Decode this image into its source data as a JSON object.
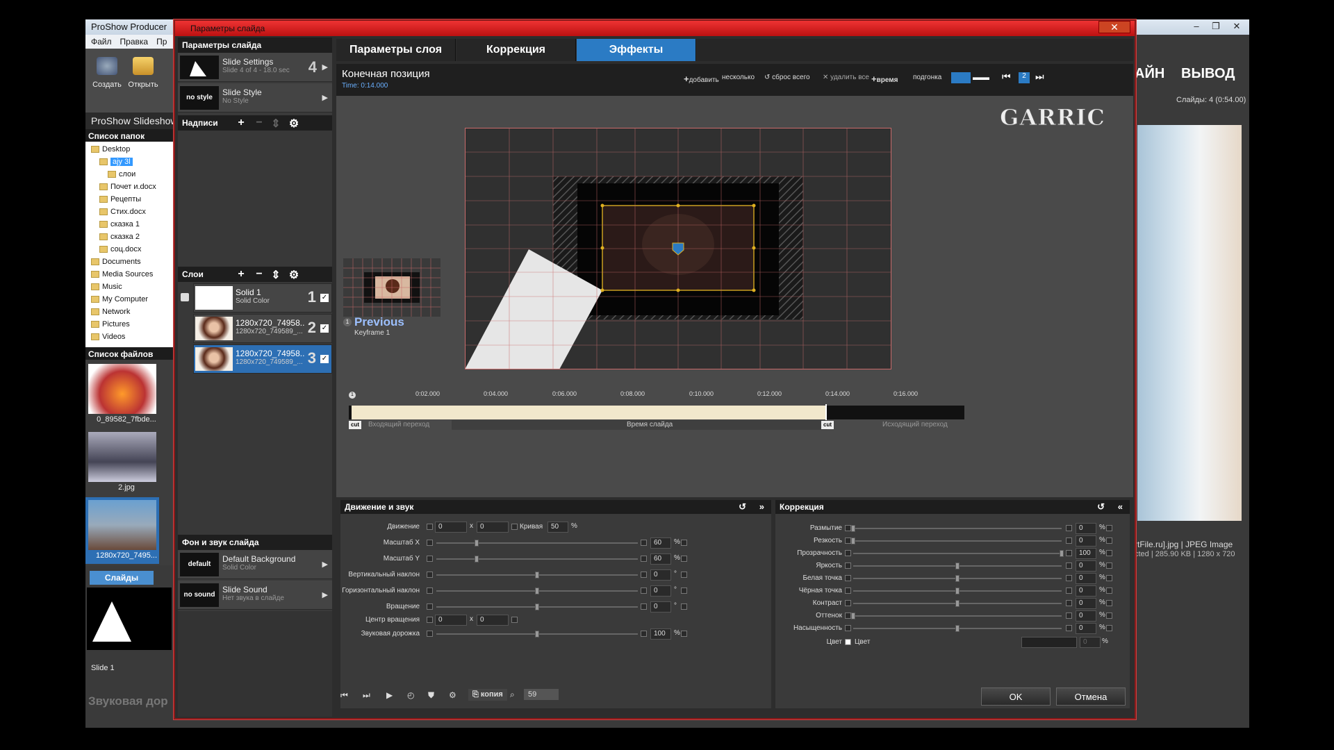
{
  "app": {
    "title": "ProShow Producer",
    "menu": [
      "Файл",
      "Правка",
      "Пр"
    ],
    "tools": [
      "Создать",
      "Открыть"
    ],
    "subtitle": "ProShow Slideshow",
    "folders_header": "Список папок",
    "folders": [
      {
        "name": "Desktop",
        "selected": false
      },
      {
        "name": "ajy 3l",
        "selected": true
      },
      {
        "name": "слои",
        "selected": false
      },
      {
        "name": "Почет и.docx",
        "selected": false
      },
      {
        "name": "Рецепты",
        "selected": false
      },
      {
        "name": "Стих.docx",
        "selected": false
      },
      {
        "name": "сказка 1",
        "selected": false
      },
      {
        "name": "сказка 2",
        "selected": false
      },
      {
        "name": "соц.docx",
        "selected": false
      },
      {
        "name": "Documents",
        "selected": false
      },
      {
        "name": "Media Sources",
        "selected": false
      },
      {
        "name": "Music",
        "selected": false
      },
      {
        "name": "My Computer",
        "selected": false
      },
      {
        "name": "Network",
        "selected": false
      },
      {
        "name": "Pictures",
        "selected": false
      },
      {
        "name": "Videos",
        "selected": false
      }
    ],
    "files_header": "Список файлов",
    "files": [
      "0_89582_7fbde...",
      "2.jpg",
      "1280x720_7495..."
    ],
    "slides_tab": "Слайды",
    "slide_label": "Slide 1",
    "sound_track_label": "Звуковая дор",
    "right_heading_1": "АЙН",
    "right_heading_2": "ВЫВОД",
    "slides_count": "Слайды: 4 (0:54.00)",
    "file_info_1": "rtFile.ru].jpg  |  JPEG Image",
    "file_info_2": "cted  |  285.90 KB  |  1280 x 720"
  },
  "dialog": {
    "title": "Параметры слайда",
    "left_header": "Параметры слайда",
    "slide_settings": {
      "title": "Slide Settings",
      "sub": "Slide 4 of 4 - 18.0 sec",
      "num": "4"
    },
    "slide_style": {
      "box": "no style",
      "title": "Slide Style",
      "sub": "No Style"
    },
    "captions_header": "Надписи",
    "layers_header": "Слои",
    "layers": [
      {
        "title": "Solid 1",
        "sub": "Solid Color",
        "num": "1",
        "selected": false
      },
      {
        "title": "1280x720_74958...",
        "sub": "1280x720_749589_...",
        "num": "2",
        "selected": false
      },
      {
        "title": "1280x720_74958...",
        "sub": "1280x720_749589_...",
        "num": "3",
        "selected": true
      }
    ],
    "bg_header": "Фон и звук слайда",
    "background": {
      "box": "default",
      "title": "Default Background",
      "sub": "Solid Color"
    },
    "sound": {
      "box": "no sound",
      "title": "Slide Sound",
      "sub": "Нет звука в слайде"
    },
    "tabs": [
      "Параметры слоя",
      "Коррекция",
      "Эффекты"
    ],
    "active_tab": 2,
    "preview": {
      "title": "Конечная позиция",
      "time": "Time: 0:14.000",
      "buttons": [
        "добавить",
        "несколько",
        "сброс всего",
        "удалить все",
        "время",
        "подгонка"
      ],
      "nav_badge": "2",
      "watermark": "GARRIC",
      "previous_label": "Previous",
      "previous_sub": "Keyframe 1"
    },
    "timeline": {
      "ticks": [
        "0:02.000",
        "0:04.000",
        "0:06.000",
        "0:08.000",
        "0:10.000",
        "0:12.000",
        "0:14.000",
        "0:16.000"
      ],
      "marker": "1",
      "progress_fraction": 0.775,
      "left_label": "Входящий переход",
      "mid_label": "Время слайда",
      "right_label": "Исходящий переход",
      "cut": "cut"
    },
    "motion": {
      "header": "Движение и звук",
      "rows": [
        {
          "label": "Движение",
          "v1": "0",
          "v2": "0",
          "curve_label": "Кривая",
          "curve": "50",
          "unit": "%"
        },
        {
          "label": "Масштаб X",
          "value": "60",
          "unit": "%",
          "pos": 0.2
        },
        {
          "label": "Масштаб Y",
          "value": "60",
          "unit": "%",
          "pos": 0.2
        },
        {
          "label": "Вертикальный наклон",
          "value": "0",
          "unit": "°",
          "pos": 0.5
        },
        {
          "label": "Горизонтальный наклон",
          "value": "0",
          "unit": "°",
          "pos": 0.5
        },
        {
          "label": "Вращение",
          "value": "0",
          "unit": "°",
          "pos": 0.5
        },
        {
          "label": "Центр вращения",
          "v1": "0",
          "v2": "0"
        },
        {
          "label": "Звуковая дорожка",
          "value": "100",
          "unit": "%",
          "pos": 0.5
        }
      ]
    },
    "correction": {
      "header": "Коррекция",
      "rows": [
        {
          "label": "Размытие",
          "value": "0",
          "pos": 0.0
        },
        {
          "label": "Резкость",
          "value": "0",
          "pos": 0.0
        },
        {
          "label": "Прозрачность",
          "value": "100",
          "pos": 1.0
        },
        {
          "label": "Яркость",
          "value": "0",
          "pos": 0.5
        },
        {
          "label": "Белая точка",
          "value": "0",
          "pos": 0.5
        },
        {
          "label": "Чёрная точка",
          "value": "0",
          "pos": 0.5
        },
        {
          "label": "Контраст",
          "value": "0",
          "pos": 0.5
        },
        {
          "label": "Оттенок",
          "value": "0",
          "pos": 0.0
        },
        {
          "label": "Насыщенность",
          "value": "0",
          "pos": 0.5
        }
      ],
      "color_label": "Цвет",
      "color_check_label": "Цвет",
      "color_value": "0",
      "unit": "%"
    },
    "footer": {
      "copy": "копия",
      "zoom": "59"
    },
    "ok": "OK",
    "cancel": "Отмена"
  }
}
